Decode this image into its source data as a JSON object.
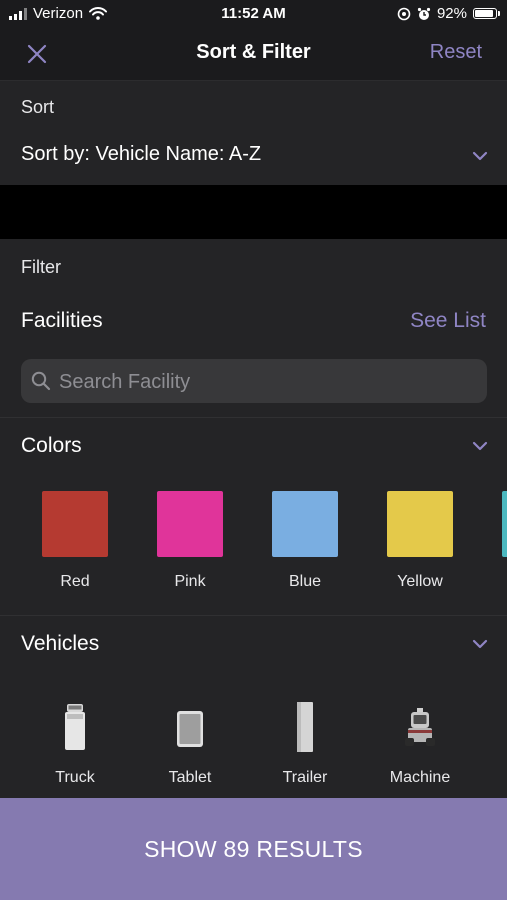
{
  "status_bar": {
    "carrier": "Verizon",
    "time": "11:52 AM",
    "battery": "92%",
    "battery_level": 0.92
  },
  "nav": {
    "title": "Sort & Filter",
    "reset_label": "Reset",
    "close_icon": "close-icon"
  },
  "sort": {
    "section_label": "Sort",
    "value": "Sort by: Vehicle Name: A-Z"
  },
  "filter": {
    "section_label": "Filter",
    "facilities": {
      "title": "Facilities",
      "see_list_label": "See List",
      "search_placeholder": "Search Facility"
    },
    "colors": {
      "title": "Colors",
      "items": [
        {
          "label": "Red",
          "color": "#b53a31"
        },
        {
          "label": "Pink",
          "color": "#e0349a"
        },
        {
          "label": "Blue",
          "color": "#7aaee1"
        },
        {
          "label": "Yellow",
          "color": "#e4c94a"
        },
        {
          "label": "",
          "color": "#4bb8bf"
        }
      ]
    },
    "vehicles": {
      "title": "Vehicles",
      "items": [
        {
          "label": "Truck",
          "icon": "truck-icon"
        },
        {
          "label": "Tablet",
          "icon": "tablet-icon"
        },
        {
          "label": "Trailer",
          "icon": "trailer-icon"
        },
        {
          "label": "Machine",
          "icon": "machine-icon"
        }
      ]
    }
  },
  "cta": {
    "label": "SHOW 89 RESULTS"
  },
  "accent_color": "#8f85c4"
}
